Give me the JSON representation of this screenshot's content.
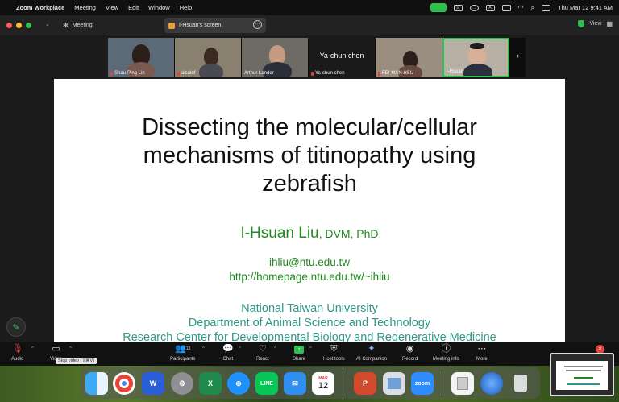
{
  "menubar": {
    "app_name": "Zoom Workplace",
    "items": [
      "Meeting",
      "View",
      "Edit",
      "Window",
      "Help"
    ],
    "datetime": "Thu Mar 12  9:41 AM"
  },
  "titlebar": {
    "meeting_tab": "Meeting",
    "screen_tab": "I-Hsuan's screen",
    "view_label": "View"
  },
  "participants_strip": [
    {
      "name": "Shau-Ping Lin",
      "muted": true
    },
    {
      "name": "alcalof",
      "muted": true
    },
    {
      "name": "Arthur Lander",
      "muted": false
    },
    {
      "name": "Ya-chun chen",
      "muted": true,
      "video_off_label": "Ya-chun chen"
    },
    {
      "name": "FEI-MAN HSU",
      "muted": true
    },
    {
      "name": "I-Hsuan",
      "muted": false,
      "active_speaker": true
    }
  ],
  "slide": {
    "title_lines": [
      "Dissecting the molecular/cellular",
      "mechanisms of titinopathy using",
      "zebrafish"
    ],
    "author_name": "I-Hsuan Liu",
    "author_degree": ", DVM, PhD",
    "email": "ihliu@ntu.edu.tw",
    "url": "http://homepage.ntu.edu.tw/~ihliu",
    "institutions": [
      "National Taiwan University",
      "Department of Animal Science and Technology",
      "Research Center for Developmental Biology and Regenerative Medicine"
    ]
  },
  "toolbar": {
    "audio": "Audio",
    "video": "Video",
    "participants": "Participants",
    "participants_count": "13",
    "chat": "Chat",
    "react": "React",
    "share": "Share",
    "host_tools": "Host tools",
    "ai_companion": "AI Companion",
    "record": "Record",
    "meeting_info": "Meeting info",
    "more": "More",
    "tooltip": "Stop video (⇧⌘V)"
  },
  "dock": {
    "calendar_month": "MAR",
    "calendar_day": "12",
    "zoom_label": "zoom"
  },
  "colors": {
    "slide_green": "#1e8a1e",
    "slide_teal": "#2e9a88",
    "active_speaker_border": "#2fbf4f",
    "mute_red": "#e2423a"
  }
}
